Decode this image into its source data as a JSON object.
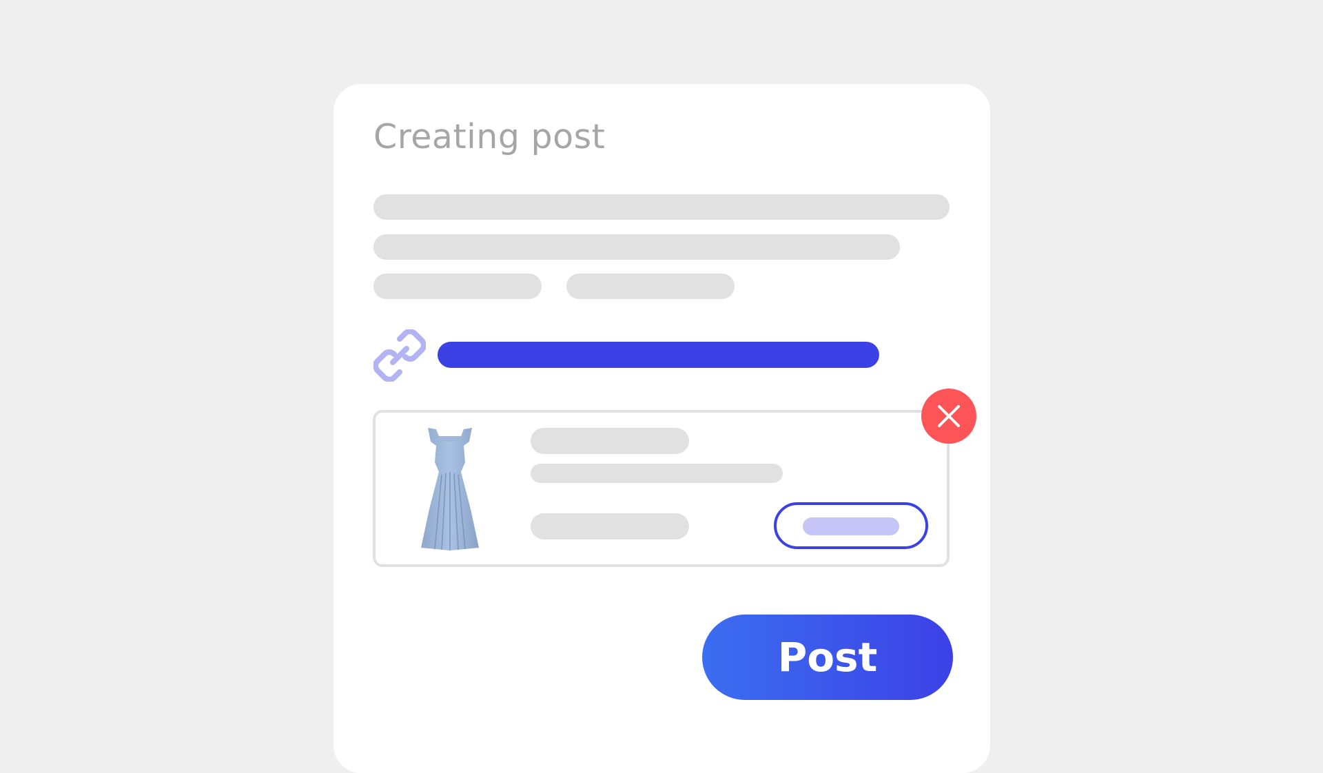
{
  "card": {
    "title": "Creating post"
  },
  "icons": {
    "link": "link-icon",
    "remove": "close-icon",
    "product": "dress-image"
  },
  "colors": {
    "accent": "#3c41e6",
    "accent_light": "#c5c6f7",
    "link_icon": "#b3b3f3",
    "remove": "#fd5457",
    "placeholder": "#e1e1e1",
    "title": "#a6a6a6"
  },
  "actions": {
    "post_label": "Post"
  }
}
